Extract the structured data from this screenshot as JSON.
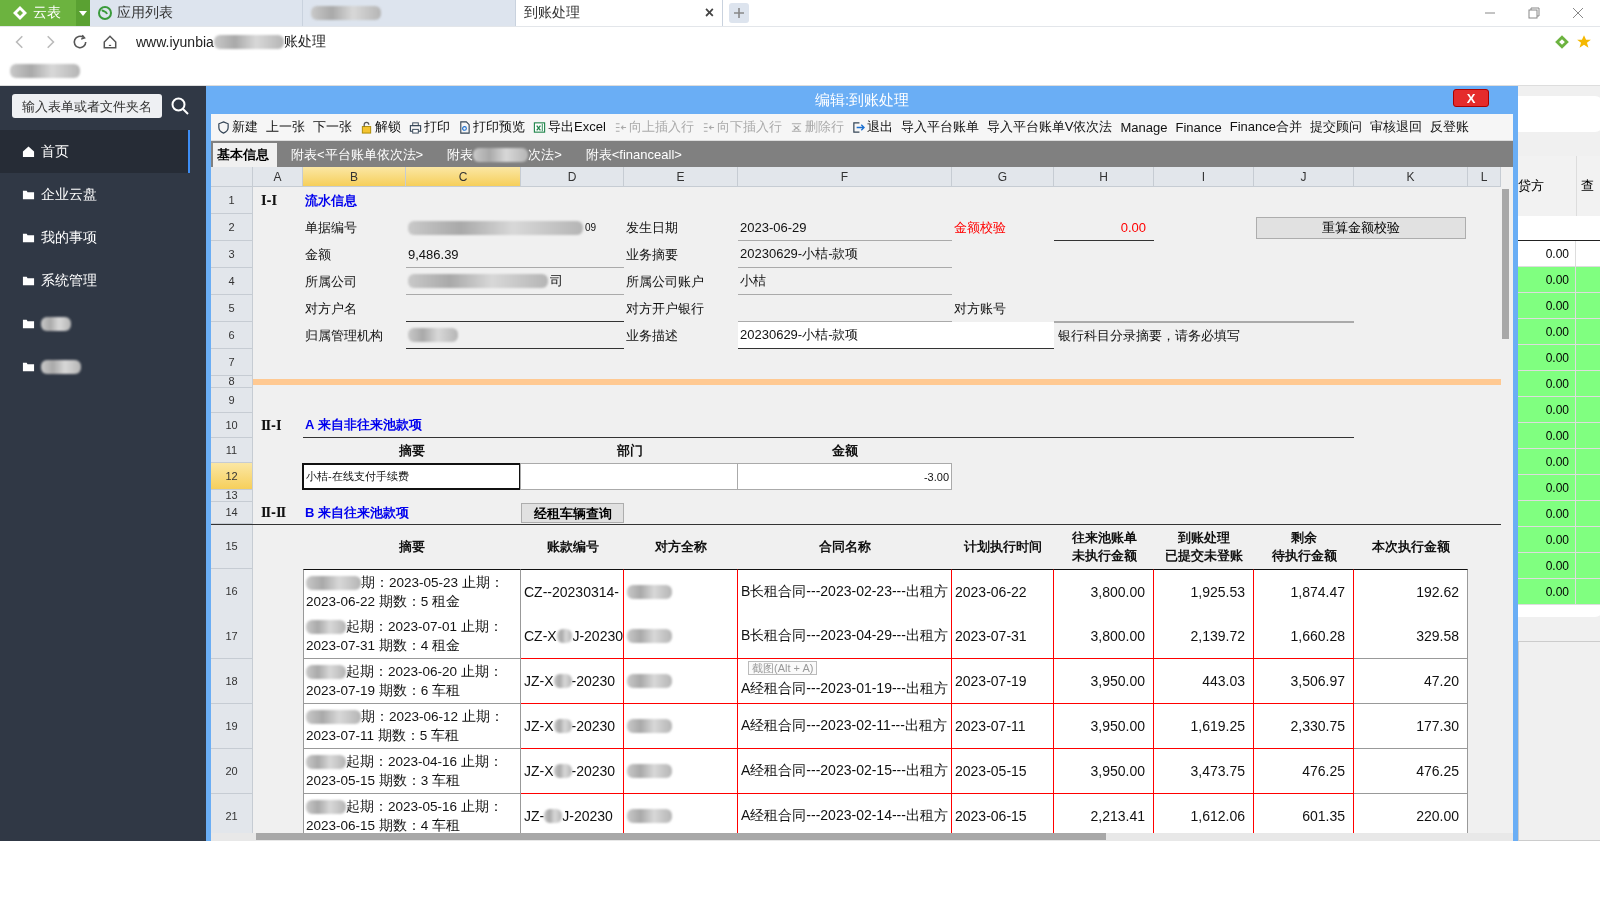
{
  "browser": {
    "logo": "云表",
    "tabs": [
      {
        "label": "应用列表",
        "selected": false
      },
      {
        "selected": false
      },
      {
        "label": "到账处理",
        "selected": true,
        "close": "×"
      }
    ],
    "url_prefix": "www.iyunbia",
    "url_suffix": "账处理"
  },
  "sidebar": {
    "search_placeholder": "输入表单或者文件夹名",
    "items": [
      {
        "label": "首页",
        "selected": true
      },
      {
        "label": "企业云盘",
        "selected": false
      },
      {
        "label": "我的事项",
        "selected": false
      },
      {
        "label": "系统管理",
        "selected": false
      }
    ]
  },
  "dialog": {
    "title": "编辑:到账处理",
    "close": "X",
    "toolbar": [
      {
        "label": "新建",
        "disabled": false
      },
      {
        "label": "上一张",
        "disabled": false
      },
      {
        "label": "下一张",
        "disabled": false
      },
      {
        "label": "解锁",
        "disabled": false
      },
      {
        "label": "打印",
        "disabled": false
      },
      {
        "label": "打印预览",
        "disabled": false
      },
      {
        "label": "导出Excel",
        "disabled": false
      },
      {
        "label": "向上插入行",
        "disabled": true
      },
      {
        "label": "向下插入行",
        "disabled": true
      },
      {
        "label": "删除行",
        "disabled": true
      },
      {
        "label": "退出",
        "disabled": false
      },
      {
        "label": "导入平台账单",
        "disabled": false
      },
      {
        "label": "导入平台账单V依次法",
        "disabled": false
      },
      {
        "label": "Manage",
        "disabled": false
      },
      {
        "label": "Finance",
        "disabled": false
      },
      {
        "label": "Finance合并",
        "disabled": false
      },
      {
        "label": "提交顾问",
        "disabled": false
      },
      {
        "label": "审核退回",
        "disabled": false
      },
      {
        "label": "反登账",
        "disabled": false
      }
    ],
    "sheet_tabs": [
      {
        "label": "基本信息",
        "selected": true
      },
      {
        "label": "附表<平台账单依次法>",
        "selected": false
      },
      {
        "label": "附表",
        "suffix": "次法>",
        "selected": false
      },
      {
        "label": "附表<financeall>",
        "selected": false
      }
    ]
  },
  "sheet": {
    "columns": [
      {
        "label": "A",
        "selected": false
      },
      {
        "label": "B",
        "selected": true
      },
      {
        "label": "C",
        "selected": true
      },
      {
        "label": "D",
        "selected": false
      },
      {
        "label": "E",
        "selected": false
      },
      {
        "label": "F",
        "selected": false
      },
      {
        "label": "G",
        "selected": false
      },
      {
        "label": "H",
        "selected": false
      },
      {
        "label": "I",
        "selected": false
      },
      {
        "label": "J",
        "selected": false
      },
      {
        "label": "K",
        "selected": false
      },
      {
        "label": "L",
        "selected": false
      }
    ],
    "row_numbers": [
      {
        "label": "1",
        "selected": false
      },
      {
        "label": "2",
        "selected": false
      },
      {
        "label": "3",
        "selected": false
      },
      {
        "label": "4",
        "selected": false
      },
      {
        "label": "5",
        "selected": false
      },
      {
        "label": "6",
        "selected": false
      },
      {
        "label": "7",
        "selected": false
      },
      {
        "label": "8",
        "selected": false
      },
      {
        "label": "9",
        "selected": false
      },
      {
        "label": "10",
        "selected": false
      },
      {
        "label": "11",
        "selected": false
      },
      {
        "label": "12",
        "selected": true
      },
      {
        "label": "13",
        "selected": false
      },
      {
        "label": "14",
        "selected": false
      },
      {
        "label": "15",
        "selected": false
      },
      {
        "label": "16",
        "selected": false
      },
      {
        "label": "17",
        "selected": false
      },
      {
        "label": "18",
        "selected": false
      },
      {
        "label": "19",
        "selected": false
      },
      {
        "label": "20",
        "selected": false
      },
      {
        "label": "21",
        "selected": false
      }
    ],
    "info": {
      "marker": "Ⅰ-Ⅰ",
      "title": "流水信息",
      "doc_no": {
        "label": "单据编号",
        "value_tail": "09"
      },
      "date": {
        "label": "发生日期",
        "value": "2023-06-29"
      },
      "check": {
        "label": "金额校验",
        "value": "0.00"
      },
      "recalc_button": "重算金额校验",
      "amount": {
        "label": "金额",
        "value": "9,486.39"
      },
      "summary": {
        "label": "业务摘要",
        "value": "20230629-小桔-款项"
      },
      "company": {
        "label": "所属公司",
        "value_tail": "司"
      },
      "company_account": {
        "label": "所属公司账户",
        "value": "小桔"
      },
      "counterparty_name": {
        "label": "对方户名"
      },
      "counterparty_bank": {
        "label": "对方开户银行"
      },
      "counterparty_account": {
        "label": "对方账号"
      },
      "org": {
        "label": "归属管理机构"
      },
      "description": {
        "label": "业务描述",
        "value": "20230629-小桔-款项"
      },
      "note": "银行科目分录摘要，请务必填写"
    },
    "section_a": {
      "marker": "Ⅱ-Ⅰ",
      "title": "A 来自非往来池款项",
      "columns": [
        "摘要",
        "部门",
        "金额"
      ],
      "rows": [
        {
          "summary": "小桔-在线支付手续费",
          "amount": "-3.00",
          "selected": true
        }
      ]
    },
    "section_b": {
      "marker": "Ⅱ-Ⅱ",
      "title": "B 来自往来池款项",
      "button": "经租车辆查询",
      "columns": [
        [
          "摘要"
        ],
        [
          "账款编号"
        ],
        [
          "对方全称"
        ],
        [
          "合同名称"
        ],
        [
          "计划执行时间"
        ],
        [
          "往来池账单",
          "未执行金额"
        ],
        [
          "到账处理",
          "已提交未登账"
        ],
        [
          "剩余",
          "待执行金额"
        ],
        [
          "本次执行金额"
        ]
      ],
      "rows": [
        {
          "summary": "期：2023-05-23  止期：2023-06-22  期数：5 租金",
          "code_prefix": "CZ--20230314-",
          "contract": "B长租合同---2023-02-23---出租方",
          "plan_date": "2023-06-22",
          "pool_amount": "3,800.00",
          "submitted": "1,925.53",
          "remaining": "1,874.47",
          "this_amount": "192.62"
        },
        {
          "summary": "起期：2023-07-01  止期：2023-07-31  期数：4 租金",
          "code_prefix": "CZ-X",
          "code_suffix": "J-20230",
          "contract": "B长租合同---2023-04-29---出租方",
          "plan_date": "2023-07-31",
          "pool_amount": "3,800.00",
          "submitted": "2,139.72",
          "remaining": "1,660.28",
          "this_amount": "329.58"
        },
        {
          "summary": "起期：2023-06-20  止期：2023-07-19  期数：6 车租",
          "code_prefix": "JZ-X",
          "code_suffix": "-20230",
          "contract": "A经租合同---2023-01-19---出租方",
          "tooltip": "截图(Alt + A)",
          "plan_date": "2023-07-19",
          "pool_amount": "3,950.00",
          "submitted": "443.03",
          "remaining": "3,506.97",
          "this_amount": "47.20"
        },
        {
          "summary": "期：2023-06-12  止期：2023-07-11  期数：5 车租",
          "code_prefix": "JZ-X",
          "code_suffix": "-20230",
          "contract": "A经租合同---2023-02-11---出租方",
          "plan_date": "2023-07-11",
          "pool_amount": "3,950.00",
          "submitted": "1,619.25",
          "remaining": "2,330.75",
          "this_amount": "177.30"
        },
        {
          "summary": "起期：2023-04-16  止期：2023-05-15  期数：3 车租",
          "code_prefix": "JZ-X",
          "code_suffix": "-20230",
          "contract": "A经租合同---2023-02-15---出租方",
          "plan_date": "2023-05-15",
          "pool_amount": "3,950.00",
          "submitted": "3,473.75",
          "remaining": "476.25",
          "this_amount": "476.25"
        },
        {
          "summary": "起期：2023-05-16  止期：2023-06-15  期数：4 车租",
          "code_prefix": "JZ-",
          "code_suffix": "J-20230",
          "contract": "A经租合同---2023-02-14---出租方",
          "plan_date": "2023-06-15",
          "pool_amount": "2,213.41",
          "submitted": "1,612.06",
          "remaining": "601.35",
          "this_amount": "220.00"
        }
      ]
    }
  },
  "side_panel": {
    "columns": [
      "贷方",
      "查"
    ],
    "values": [
      {
        "value": "0.00",
        "highlight": false
      },
      {
        "value": "0.00",
        "highlight": true
      },
      {
        "value": "0.00",
        "highlight": true
      },
      {
        "value": "0.00",
        "highlight": true
      },
      {
        "value": "0.00",
        "highlight": true
      },
      {
        "value": "0.00",
        "highlight": true
      },
      {
        "value": "0.00",
        "highlight": true
      },
      {
        "value": "0.00",
        "highlight": true
      },
      {
        "value": "0.00",
        "highlight": true
      },
      {
        "value": "0.00",
        "highlight": true
      },
      {
        "value": "0.00",
        "highlight": true
      },
      {
        "value": "0.00",
        "highlight": true
      },
      {
        "value": "0.00",
        "highlight": true
      },
      {
        "value": "0.00",
        "highlight": true
      }
    ]
  }
}
